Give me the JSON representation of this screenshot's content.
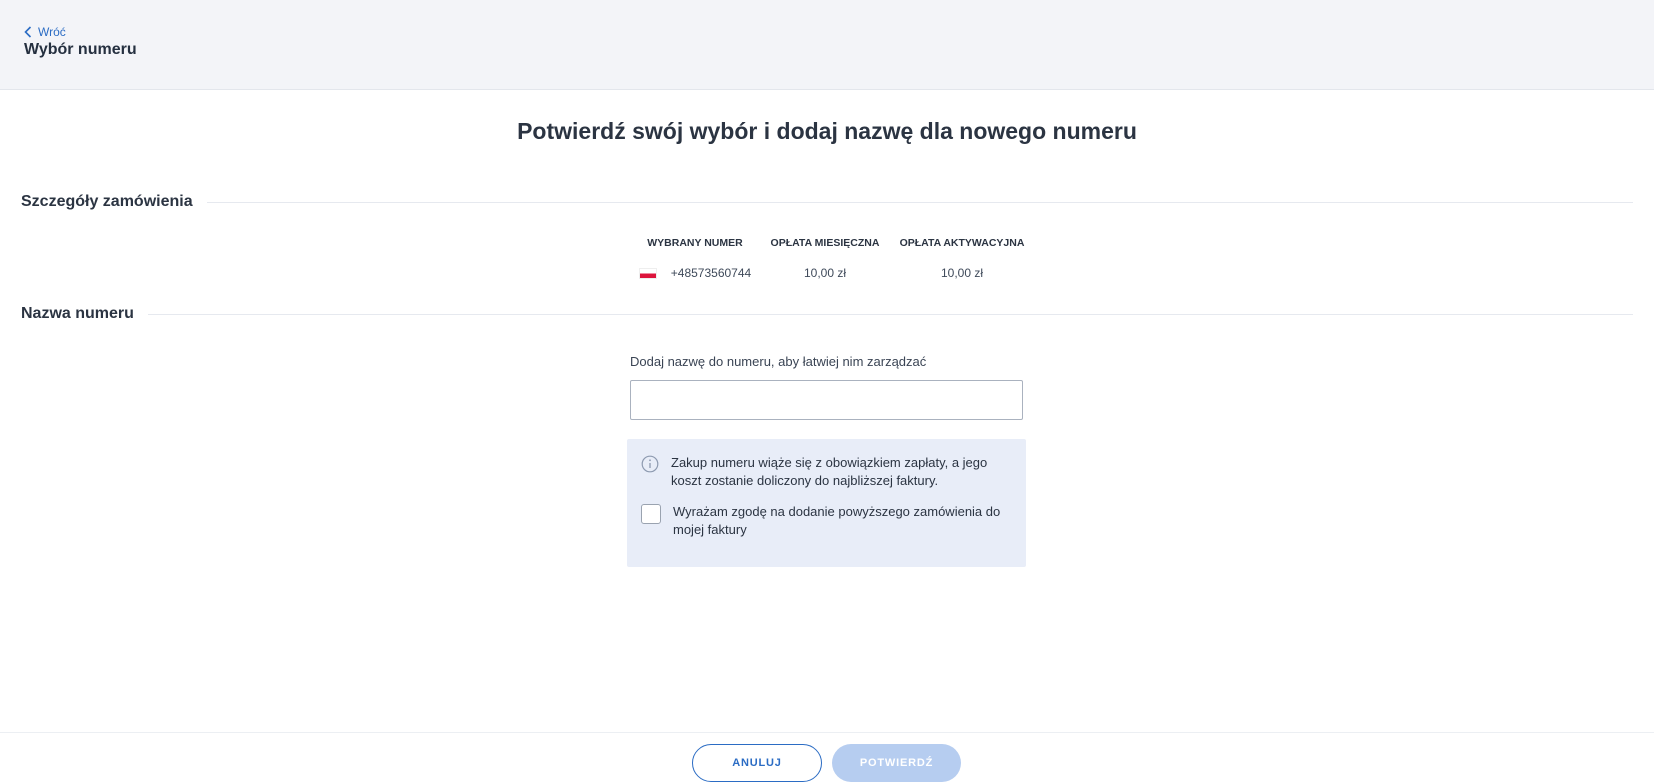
{
  "header": {
    "back_label": "Wróć",
    "page_title": "Wybór numeru"
  },
  "main": {
    "heading": "Potwierdź swój wybór i dodaj nazwę dla nowego numeru"
  },
  "order_details": {
    "section_title": "Szczegóły zamówienia",
    "columns": [
      "WYBRANY NUMER",
      "OPŁATA MIESIĘCZNA",
      "OPŁATA AKTYWACYJNA"
    ],
    "row": {
      "country_flag": "poland-flag-icon",
      "number": "+48573560744",
      "monthly_fee": "10,00 zł",
      "activation_fee": "10,00 zł"
    }
  },
  "number_name": {
    "section_title": "Nazwa numeru",
    "field_label": "Dodaj nazwę do numeru, aby łatwiej nim zarządzać",
    "field_value": "",
    "info_text": "Zakup numeru wiąże się z obowiązkiem zapłaty, a jego koszt zostanie doliczony do najbliższej faktury.",
    "consent_text": "Wyrażam zgodę na dodanie powyższego zamówienia do mojej faktury",
    "consent_checked": false
  },
  "footer": {
    "cancel_label": "ANULUJ",
    "confirm_label": "POTWIERDŹ"
  },
  "colors": {
    "accent": "#2b6cc4",
    "confirm_disabled": "#b6cdf0",
    "info_box_bg": "#e8edf8",
    "header_bg": "#f3f4f8"
  }
}
